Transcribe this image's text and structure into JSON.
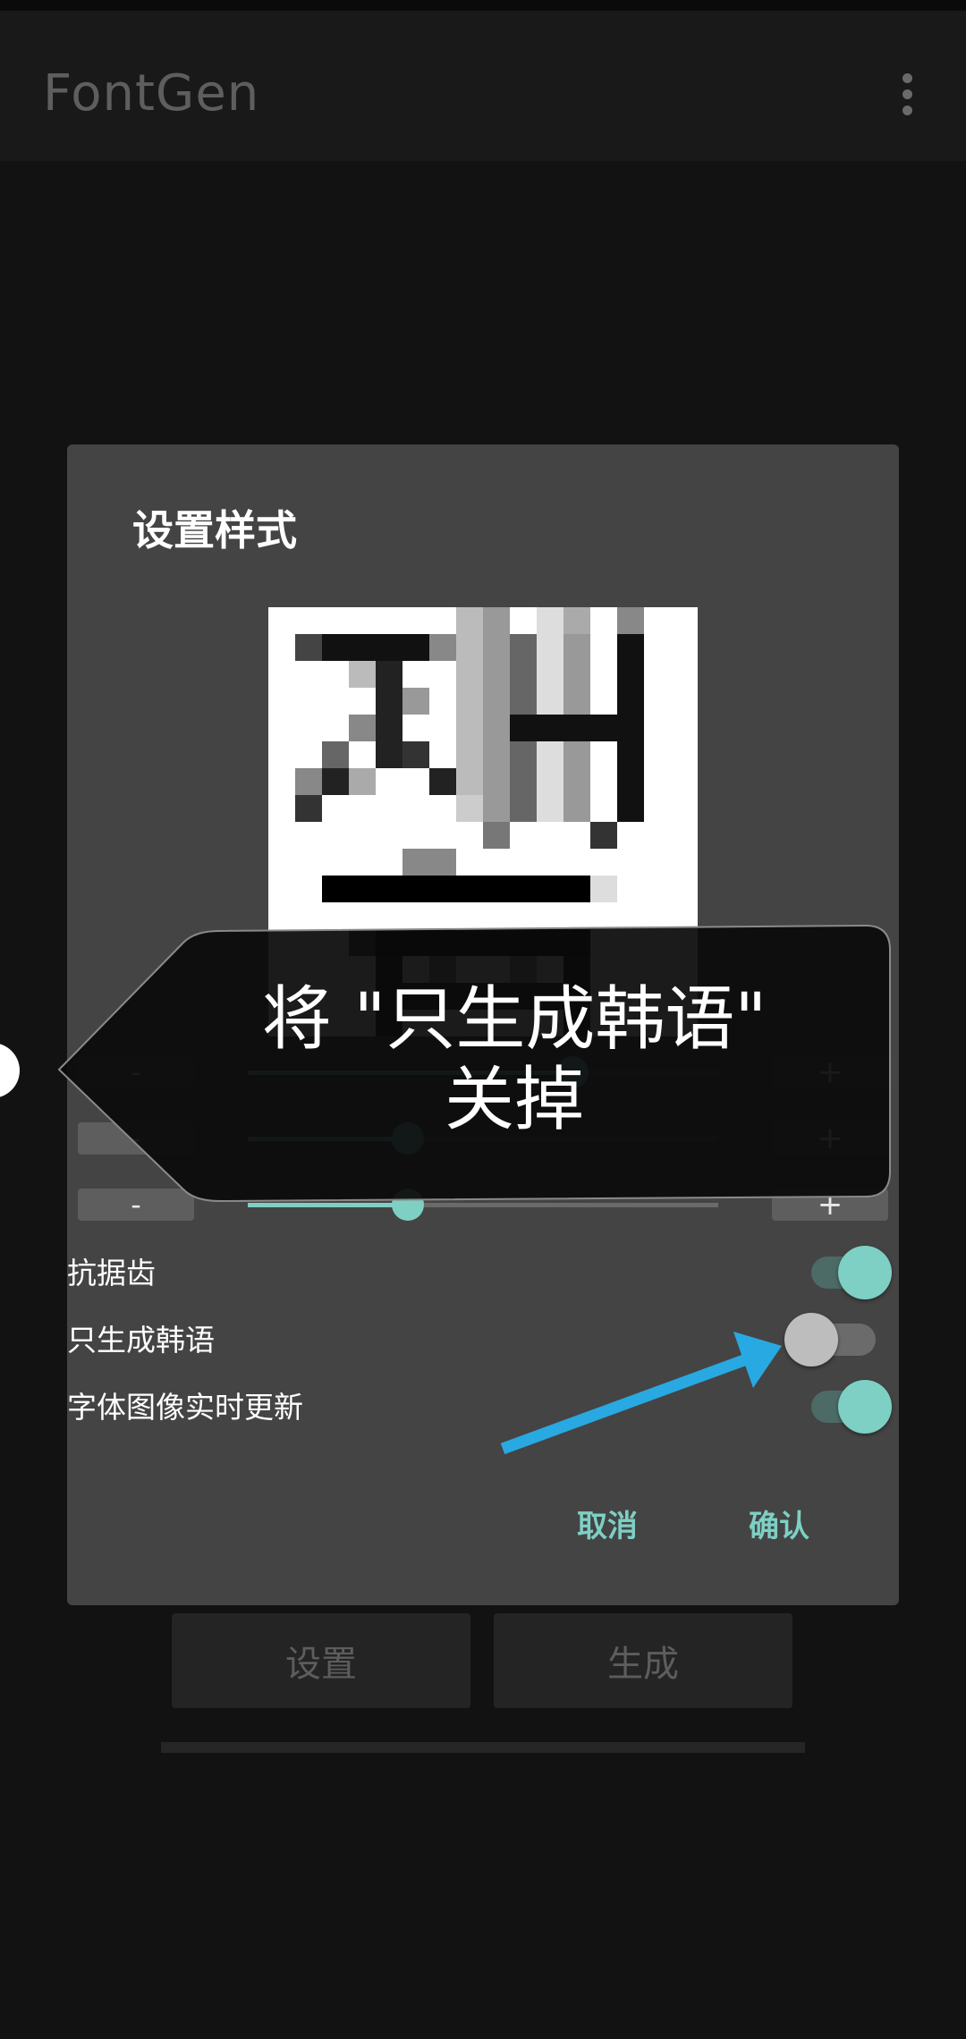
{
  "app": {
    "title": "FontGen"
  },
  "dialog": {
    "title": "设置样式",
    "sliders": [
      {
        "minus": "-",
        "plus": "+",
        "value": 0.69
      },
      {
        "minus": "-",
        "plus": "+",
        "value": 0.34
      },
      {
        "minus": "-",
        "plus": "+",
        "value": 0.34
      }
    ],
    "switches": [
      {
        "label": "抗据齿",
        "on": true
      },
      {
        "label": "只生成韩语",
        "on": false
      },
      {
        "label": "字体图像实时更新",
        "on": true
      }
    ],
    "cancel": "取消",
    "confirm": "确认"
  },
  "bottom": {
    "settings": "设置",
    "generate": "生成"
  },
  "annotation": {
    "line1": "将 \"只生成韩语\"",
    "line2": "关掉"
  },
  "colors": {
    "accent": "#7ecfc4",
    "annotation_arrow": "#29a9e1",
    "dialog_bg": "#444444"
  },
  "icons": [
    "more-vert-icon"
  ]
}
